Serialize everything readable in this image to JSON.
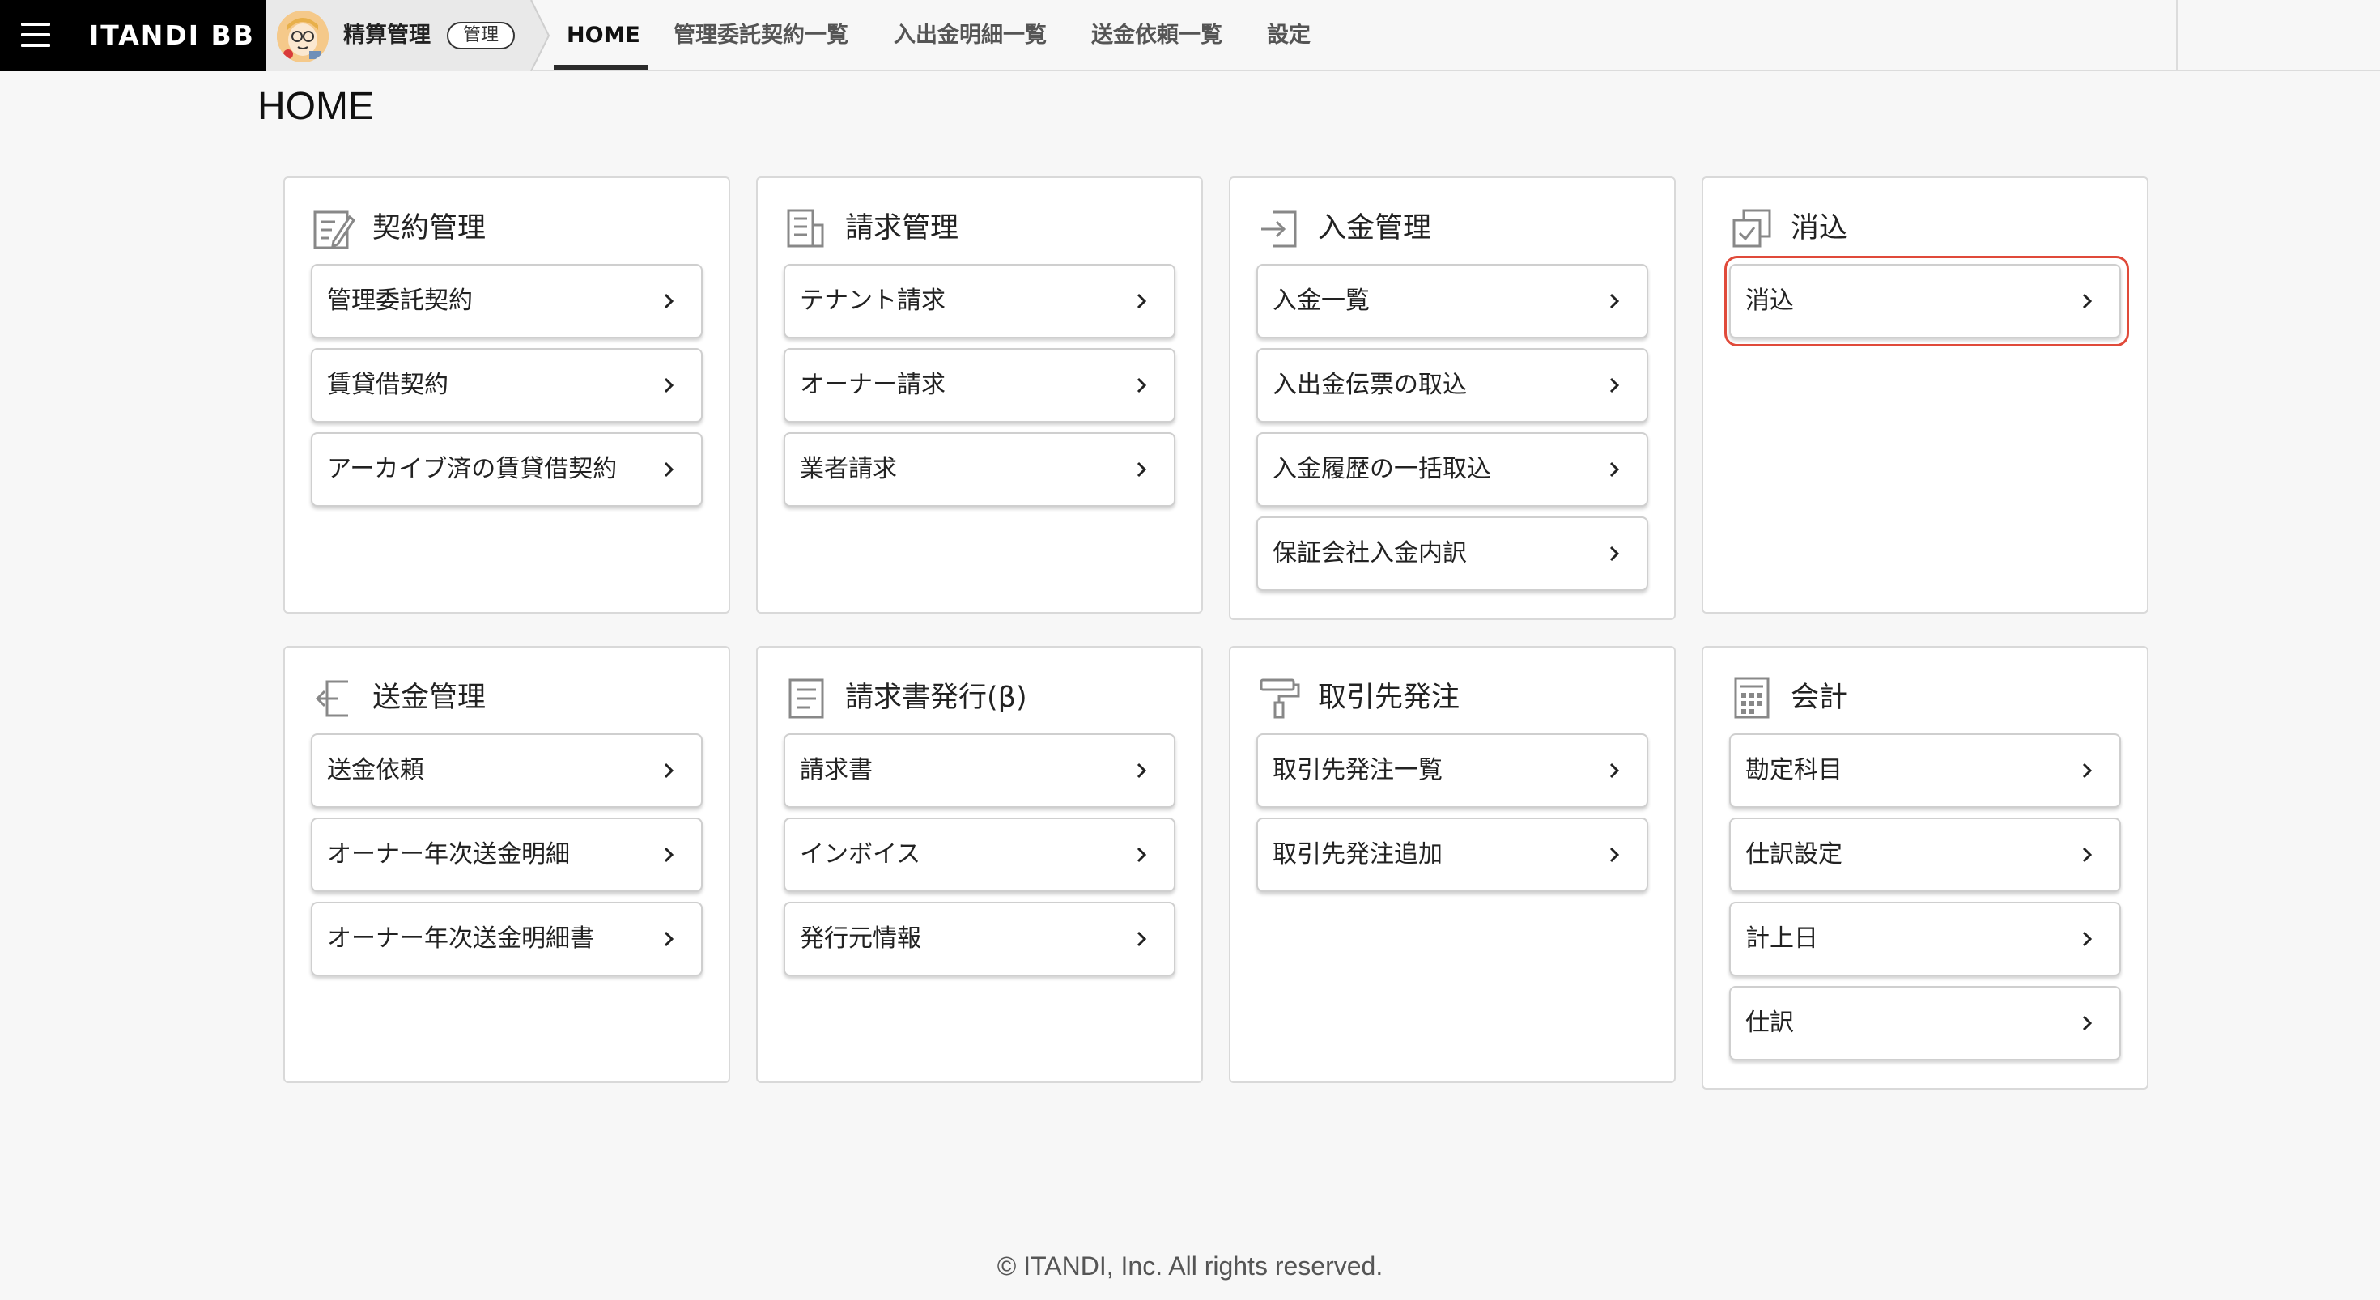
{
  "header": {
    "brand": "ITANDI BB",
    "product_name": "精算管理",
    "product_badge": "管理",
    "nav": [
      {
        "label": "HOME",
        "active": true
      },
      {
        "label": "管理委託契約一覧",
        "active": false
      },
      {
        "label": "入出金明細一覧",
        "active": false
      },
      {
        "label": "送金依頼一覧",
        "active": false
      },
      {
        "label": "設定",
        "active": false
      }
    ]
  },
  "page_title": "HOME",
  "cards": [
    {
      "title": "契約管理",
      "icon": "contract-edit-icon",
      "items": [
        "管理委託契約",
        "賃貸借契約",
        "アーカイブ済の賃貸借契約"
      ]
    },
    {
      "title": "請求管理",
      "icon": "invoice-document-icon",
      "items": [
        "テナント請求",
        "オーナー請求",
        "業者請求"
      ]
    },
    {
      "title": "入金管理",
      "icon": "deposit-in-icon",
      "items": [
        "入金一覧",
        "入出金伝票の取込",
        "入金履歴の一括取込",
        "保証会社入金内訳"
      ]
    },
    {
      "title": "消込",
      "icon": "reconcile-check-icon",
      "items": [
        "消込"
      ]
    },
    {
      "title": "送金管理",
      "icon": "remittance-out-icon",
      "items": [
        "送金依頼",
        "オーナー年次送金明細",
        "オーナー年次送金明細書"
      ]
    },
    {
      "title": "請求書発行(β)",
      "icon": "invoice-issue-icon",
      "items": [
        "請求書",
        "インボイス",
        "発行元情報"
      ]
    },
    {
      "title": "取引先発注",
      "icon": "paint-roller-icon",
      "items": [
        "取引先発注一覧",
        "取引先発注追加"
      ]
    },
    {
      "title": "会計",
      "icon": "calculator-icon",
      "items": [
        "勘定科目",
        "仕訳設定",
        "計上日",
        "仕訳"
      ]
    }
  ],
  "highlighted_item": "消込",
  "footer": "© ITANDI, Inc. All rights reserved.",
  "colors": {
    "highlight": "#e04a3a",
    "brand_bg": "#000000"
  }
}
